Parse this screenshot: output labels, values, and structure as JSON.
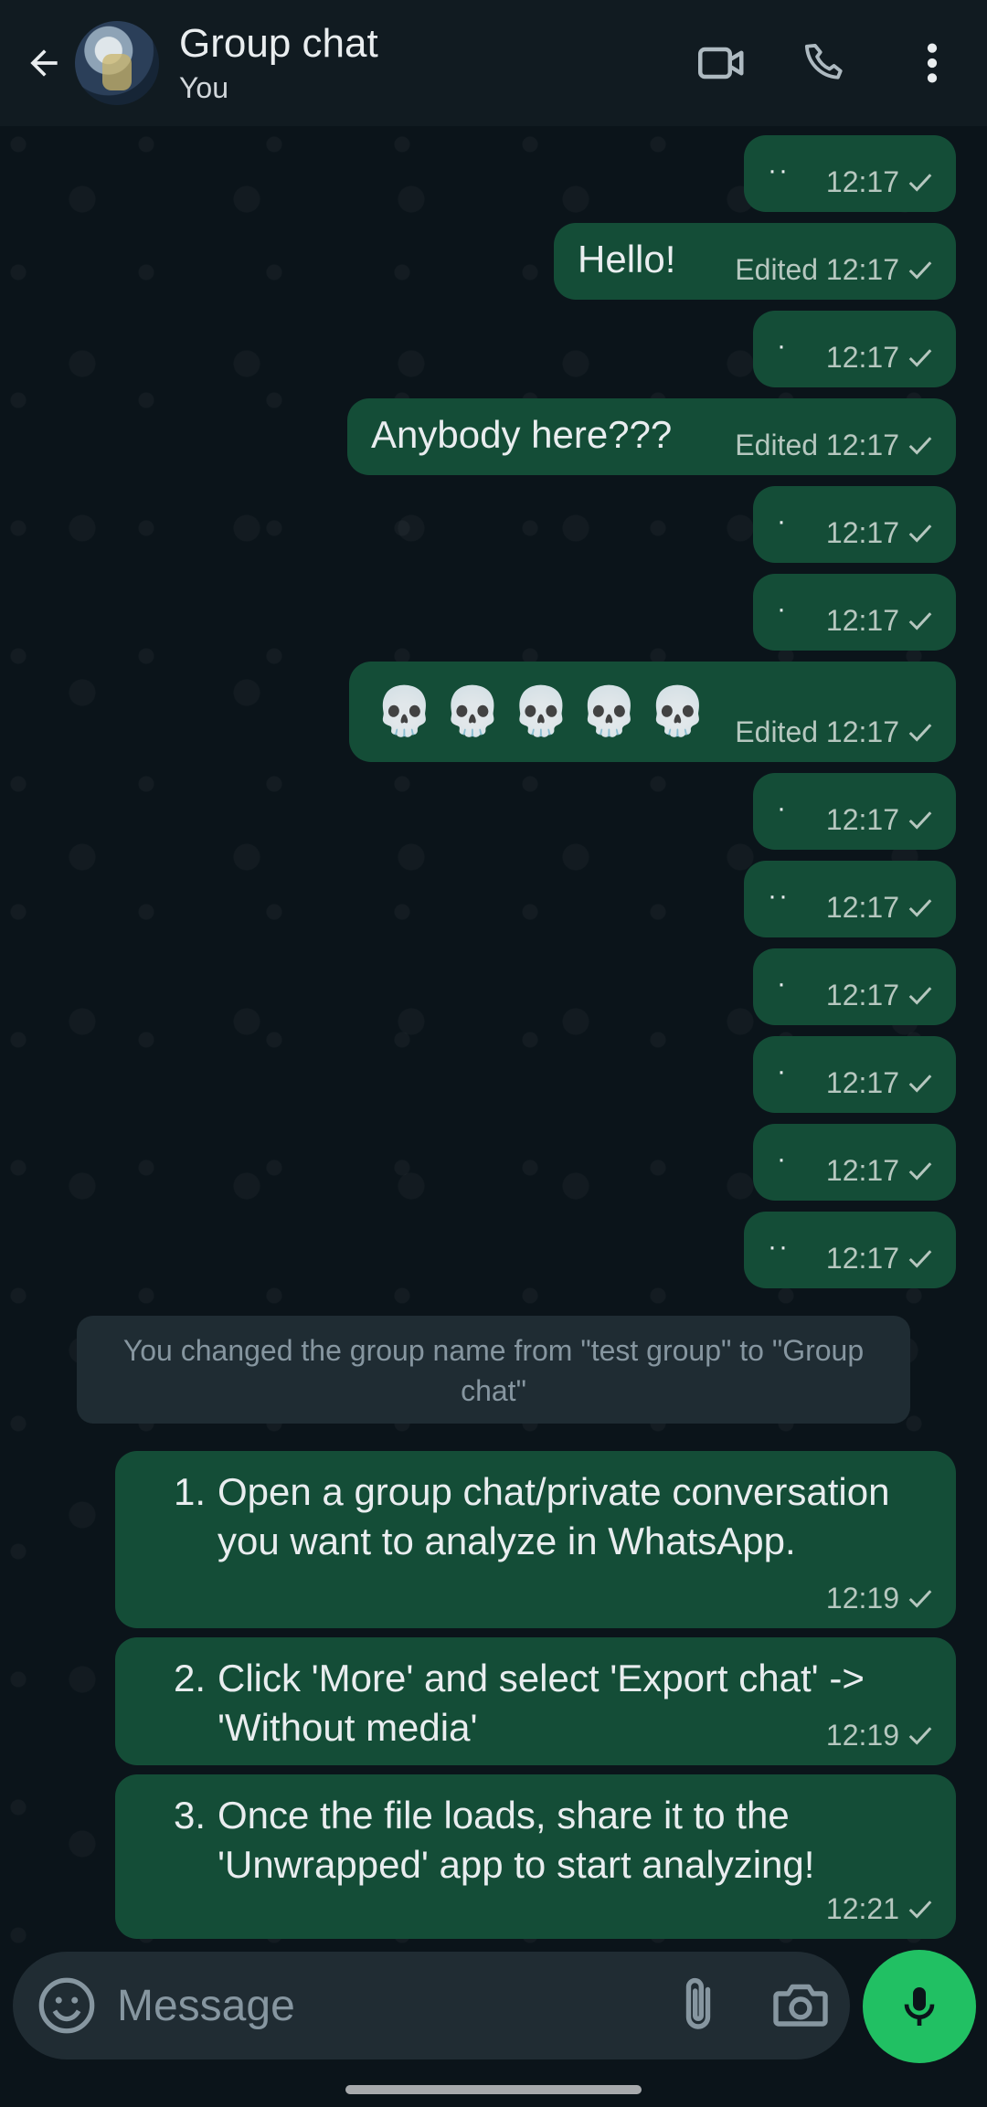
{
  "header": {
    "title": "Group chat",
    "subtitle": "You"
  },
  "messages": [
    {
      "text": "··",
      "meta": "12:17"
    },
    {
      "text": "Hello!",
      "meta": "Edited 12:17"
    },
    {
      "text": "·",
      "meta": "12:17"
    },
    {
      "text": "Anybody here???",
      "meta": "Edited 12:17"
    },
    {
      "text": "·",
      "meta": "12:17"
    },
    {
      "text": "·",
      "meta": "12:17"
    },
    {
      "text": "💀💀💀💀💀",
      "meta": "Edited 12:17"
    },
    {
      "text": "·",
      "meta": "12:17"
    },
    {
      "text": "··",
      "meta": "12:17"
    },
    {
      "text": "·",
      "meta": "12:17"
    },
    {
      "text": "·",
      "meta": "12:17"
    },
    {
      "text": "·",
      "meta": "12:17"
    },
    {
      "text": "··",
      "meta": "12:17"
    }
  ],
  "system_message": "You changed the group name from \"test group\" to \"Group chat\"",
  "list_messages": [
    {
      "number": "1.",
      "text": "Open a group chat/private conversation you want to analyze in WhatsApp.",
      "time": "12:19"
    },
    {
      "number": "2.",
      "text": "Click 'More' and select 'Export chat' -> 'Without media'",
      "time": "12:19"
    },
    {
      "number": "3.",
      "text": "Once the file loads, share it to the 'Unwrapped' app to start analyzing!",
      "time": "12:21"
    }
  ],
  "input": {
    "placeholder": "Message"
  },
  "icons": {
    "back": "arrow-left-icon",
    "video": "video-camera-icon",
    "call": "phone-icon",
    "menu": "more-vert-icon",
    "emoji": "smiley-icon",
    "attach": "paperclip-icon",
    "camera": "camera-icon",
    "mic": "microphone-icon"
  },
  "colors": {
    "header_bg": "#111b21",
    "chat_bg": "#0b141a",
    "outgoing_bubble": "#144d37",
    "accent": "#21c063"
  }
}
